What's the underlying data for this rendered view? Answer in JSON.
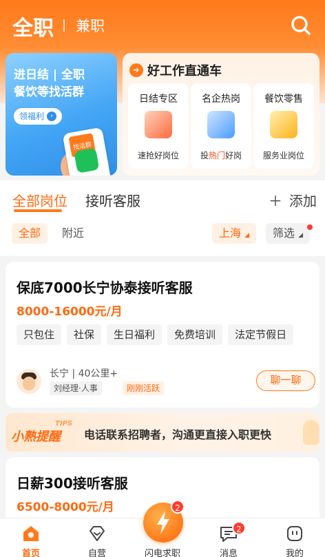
{
  "header": {
    "tab_active": "全职",
    "tab_inactive": "兼职"
  },
  "promo": {
    "line1": "进日结 | 全职",
    "line2": "餐饮等找活群",
    "button": "领福利",
    "phone_tag": "找活群"
  },
  "direct": {
    "title": "好工作直通车",
    "categories": [
      {
        "name": "日结专区",
        "sub": "速抢好岗位"
      },
      {
        "name": "名企热岗",
        "sub_pre": "投",
        "sub_hl": "热门",
        "sub_post": "好岗"
      },
      {
        "name": "餐饮零售",
        "sub": "服务业岗位"
      }
    ]
  },
  "filters": {
    "tab_all": "全部岗位",
    "tab_cs": "接听客服",
    "add": "添加",
    "chip_all": "全部",
    "chip_near": "附近",
    "city": "上海",
    "filter": "筛选"
  },
  "jobs": [
    {
      "title": "保底7000长宁协泰接听客服",
      "salary": "8000-16000元/月",
      "tags": [
        "只包住",
        "社保",
        "生日福利",
        "免费培训",
        "法定节假日"
      ],
      "location": "长宁 | 40公里+",
      "recruiter": "刘经理·人事",
      "active": "刚刚活跃",
      "chat": "聊一聊"
    },
    {
      "title": "日薪300接听客服",
      "salary": "6500-8000元/月"
    }
  ],
  "tips": {
    "tag": "TIPS",
    "name": "小熟提醒",
    "text": "电话联系招聘者，沟通更直接入职更快"
  },
  "nav": {
    "home": "首页",
    "self": "自营",
    "flash": "闪电求职",
    "flash_badge": "2",
    "messages": "消息",
    "messages_badge": "2",
    "mine": "我的"
  },
  "colors": {
    "accent": "#ff7a1a",
    "accent_text": "#ff6a10",
    "badge": "#ff3b30"
  }
}
